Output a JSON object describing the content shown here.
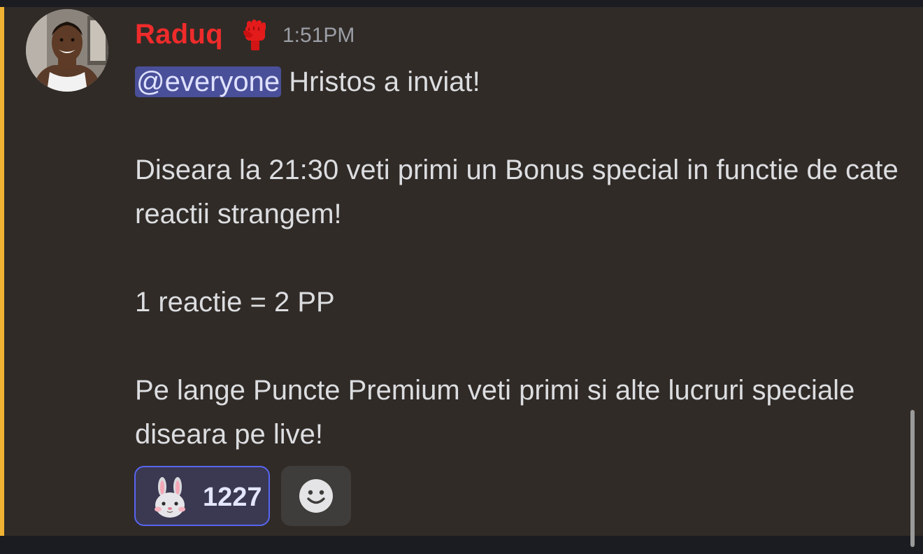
{
  "message": {
    "author": {
      "username": "Raduq",
      "username_color": "#ef2b2b",
      "avatar_icon": "avatar-photo",
      "role_icon": "raised-fist-icon"
    },
    "timestamp": "1:51PM",
    "mention": "@everyone",
    "first_line_text": " Hristos a inviat!",
    "paragraphs": [
      "Diseara la 21:30 veti primi un Bonus special in functie de cate reactii strangem!",
      "1 reactie = 2 PP",
      "Pe lange Puncte Premium veti primi si alte lucruri speciale diseara pe live!"
    ],
    "mention_highlight_color": "#f0b232"
  },
  "reactions": [
    {
      "emoji_icon": "rabbit-face-icon",
      "count": "1227",
      "selected": true
    }
  ],
  "add_reaction": {
    "icon": "smiley-add-reaction-icon"
  },
  "colors": {
    "background": "#302b27",
    "mention_bg": "#4a4f99",
    "reaction_border": "#5865f2",
    "text": "#dcdde0"
  }
}
